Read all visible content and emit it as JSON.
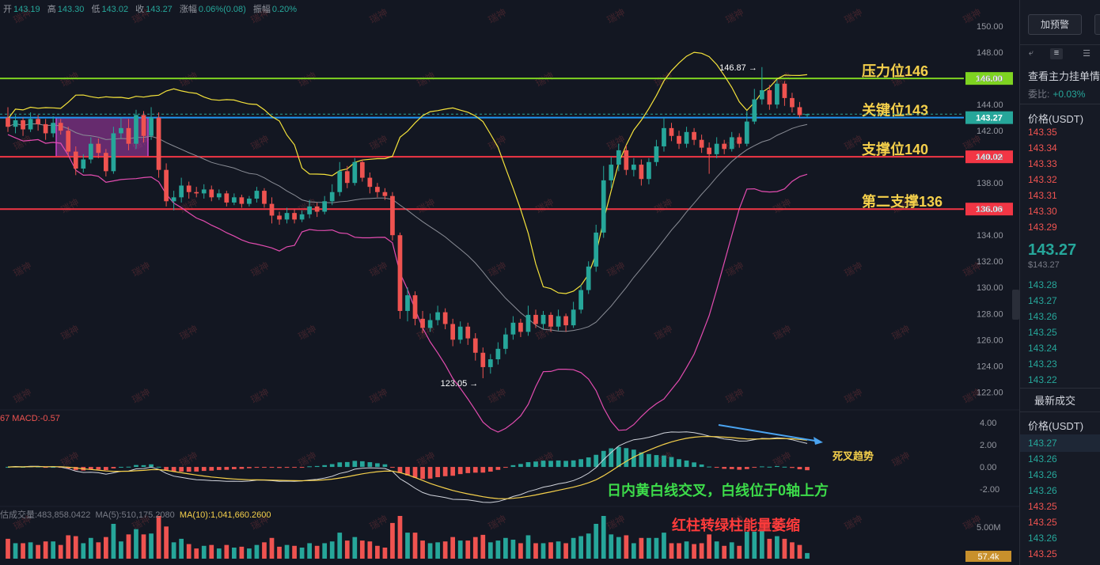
{
  "ohlc": {
    "open_label": "开",
    "open": "143.19",
    "high_label": "高",
    "high": "143.30",
    "low_label": "低",
    "low": "143.02",
    "close_label": "收",
    "close": "143.27",
    "change_label": "涨幅",
    "change": "0.06%(0.08)",
    "amp_label": "振幅",
    "amp": "0.20%"
  },
  "macd_legend": "67  MACD:-0.57",
  "vol_legend": {
    "base": "估成交量:483,858.0422",
    "ma5": "MA(5):510,175.2080",
    "ma10": "MA(10):1,041,660.2600"
  },
  "chart_data": {
    "type": "candlestick",
    "price_axis": {
      "ylim": [
        120.2,
        151.4
      ],
      "ticks": [
        "150.00",
        "148.00",
        "146.00",
        "144.00",
        "142.00",
        "140.00",
        "138.00",
        "136.00",
        "134.00",
        "132.00",
        "130.00",
        "128.00",
        "126.00",
        "124.00",
        "122.00"
      ],
      "tick_values": [
        150,
        148,
        146,
        144,
        142,
        140,
        138,
        136,
        134,
        132,
        130,
        128,
        126,
        124,
        122
      ]
    },
    "macd_axis": {
      "ticks": [
        "4.00",
        "2.00",
        "0.00",
        "-2.00"
      ],
      "tick_values": [
        4,
        2,
        0,
        -2
      ]
    },
    "volume_axis": {
      "ticks": [
        "5.00M"
      ],
      "last_label": "57.4k"
    },
    "last_price_label": "143.27",
    "levels": [
      {
        "value": 146.0,
        "label": "146.00",
        "text": "压力位146",
        "color": "#7ed321"
      },
      {
        "value": 143.0,
        "label": "143.27",
        "text": "关键位143",
        "color": "#2196f3"
      },
      {
        "value": 140.0,
        "label": "140.02",
        "text": "支撑位140",
        "color": "#f23645"
      },
      {
        "value": 136.0,
        "label": "136.06",
        "text": "第二支撑136",
        "color": "#f23645"
      }
    ],
    "extreme_high": {
      "value": 146.87,
      "label": "146.87"
    },
    "extreme_low": {
      "value": 123.05,
      "label": "123.05"
    },
    "annotations": {
      "death_cross": "死叉趋势",
      "macd_note": "日内黄白线交叉，白线位于0轴上方",
      "volume_note": "红柱转绿柱能量萎缩"
    },
    "watermark": "瑞神",
    "colors": {
      "up": "#26a69a",
      "down": "#ef5350",
      "boll_mid": "#8a8d96",
      "boll_up": "#f5e33b",
      "boll_low": "#e34cb0",
      "dif": "#d1d4dc",
      "dea": "#f5d04b",
      "box": "#cc44cc"
    },
    "candles": [
      [
        143.0,
        142.3,
        143.8,
        141.9
      ],
      [
        142.3,
        142.8,
        143.2,
        141.8
      ],
      [
        142.8,
        142.1,
        143.0,
        141.6
      ],
      [
        142.1,
        142.9,
        143.4,
        141.9
      ],
      [
        142.9,
        142.5,
        143.2,
        142.0
      ],
      [
        142.5,
        141.8,
        142.9,
        141.3
      ],
      [
        141.8,
        142.6,
        143.1,
        141.5
      ],
      [
        142.6,
        142.0,
        142.9,
        141.7
      ],
      [
        142.0,
        140.4,
        142.3,
        140.0
      ],
      [
        140.4,
        139.1,
        140.8,
        138.6
      ],
      [
        139.1,
        139.8,
        140.2,
        138.8
      ],
      [
        139.8,
        141.0,
        141.5,
        139.5
      ],
      [
        141.0,
        140.3,
        141.4,
        139.9
      ],
      [
        140.3,
        138.9,
        140.6,
        138.5
      ],
      [
        138.9,
        141.8,
        142.3,
        138.7
      ],
      [
        141.8,
        142.2,
        143.0,
        141.4
      ],
      [
        142.2,
        141.0,
        142.9,
        140.5
      ],
      [
        141.0,
        143.2,
        143.6,
        140.6
      ],
      [
        143.2,
        141.6,
        143.5,
        141.1
      ],
      [
        141.6,
        143.0,
        143.8,
        141.3
      ],
      [
        143.0,
        139.0,
        143.4,
        138.4
      ],
      [
        139.0,
        136.6,
        139.5,
        136.2
      ],
      [
        136.6,
        136.9,
        137.4,
        135.9
      ],
      [
        136.9,
        137.8,
        138.4,
        136.5
      ],
      [
        137.8,
        137.3,
        138.1,
        136.8
      ],
      [
        137.3,
        137.2,
        137.7,
        136.9
      ],
      [
        137.2,
        137.5,
        137.9,
        136.8
      ],
      [
        137.5,
        136.9,
        137.8,
        136.6
      ],
      [
        136.9,
        137.2,
        137.5,
        136.7
      ],
      [
        137.2,
        136.5,
        137.4,
        136.2
      ],
      [
        136.5,
        136.9,
        137.2,
        136.3
      ],
      [
        136.9,
        136.4,
        137.1,
        136.1
      ],
      [
        136.4,
        136.8,
        137.0,
        136.2
      ],
      [
        136.8,
        137.4,
        137.7,
        136.5
      ],
      [
        137.4,
        136.4,
        137.6,
        136.1
      ],
      [
        136.4,
        135.5,
        136.9,
        134.9
      ],
      [
        135.5,
        135.2,
        135.8,
        134.8
      ],
      [
        135.2,
        135.7,
        136.1,
        134.9
      ],
      [
        135.7,
        135.2,
        136.0,
        134.9
      ],
      [
        135.2,
        135.6,
        135.9,
        135.0
      ],
      [
        135.6,
        136.2,
        136.7,
        135.3
      ],
      [
        136.2,
        135.8,
        136.5,
        135.4
      ],
      [
        135.8,
        136.6,
        137.0,
        135.6
      ],
      [
        136.6,
        137.3,
        137.9,
        136.3
      ],
      [
        137.3,
        138.9,
        139.6,
        137.0
      ],
      [
        138.9,
        138.0,
        139.3,
        137.6
      ],
      [
        138.0,
        139.6,
        139.9,
        137.8
      ],
      [
        139.6,
        138.4,
        139.8,
        138.1
      ],
      [
        138.4,
        137.7,
        138.8,
        137.2
      ],
      [
        137.7,
        137.3,
        138.0,
        136.9
      ],
      [
        137.3,
        137.0,
        137.6,
        136.7
      ],
      [
        137.0,
        134.0,
        137.3,
        133.6
      ],
      [
        134.0,
        128.2,
        134.2,
        127.6
      ],
      [
        128.2,
        129.4,
        130.0,
        127.4
      ],
      [
        129.4,
        127.6,
        129.7,
        127.1
      ],
      [
        127.6,
        126.9,
        128.2,
        126.5
      ],
      [
        126.9,
        127.5,
        128.0,
        126.6
      ],
      [
        127.5,
        128.1,
        128.6,
        127.1
      ],
      [
        128.1,
        127.2,
        128.4,
        126.8
      ],
      [
        127.2,
        126.0,
        127.6,
        125.5
      ],
      [
        126.0,
        127.0,
        127.4,
        125.7
      ],
      [
        127.0,
        126.1,
        127.3,
        125.6
      ],
      [
        126.1,
        125.0,
        126.5,
        124.4
      ],
      [
        125.0,
        123.9,
        125.4,
        123.05
      ],
      [
        123.9,
        124.5,
        124.9,
        123.4
      ],
      [
        124.5,
        125.3,
        125.8,
        124.1
      ],
      [
        125.3,
        126.4,
        126.9,
        124.9
      ],
      [
        126.4,
        127.3,
        127.8,
        126.0
      ],
      [
        127.3,
        126.6,
        127.6,
        126.2
      ],
      [
        126.6,
        127.9,
        128.6,
        126.3
      ],
      [
        127.9,
        127.2,
        128.3,
        126.9
      ],
      [
        127.2,
        127.9,
        128.2,
        126.8
      ],
      [
        127.9,
        127.0,
        128.1,
        126.6
      ],
      [
        127.0,
        127.8,
        128.3,
        126.7
      ],
      [
        127.8,
        127.1,
        128.0,
        126.6
      ],
      [
        127.1,
        128.3,
        128.9,
        126.9
      ],
      [
        128.3,
        129.8,
        130.2,
        128.0
      ],
      [
        129.8,
        131.6,
        132.0,
        129.5
      ],
      [
        131.6,
        134.2,
        134.8,
        131.2
      ],
      [
        134.2,
        138.2,
        139.3,
        133.8
      ],
      [
        138.2,
        139.4,
        140.0,
        137.6
      ],
      [
        139.4,
        140.5,
        141.0,
        138.9
      ],
      [
        140.5,
        139.0,
        140.9,
        138.6
      ],
      [
        139.0,
        139.4,
        139.9,
        138.5
      ],
      [
        139.4,
        138.3,
        139.8,
        137.8
      ],
      [
        138.3,
        139.6,
        139.9,
        137.9
      ],
      [
        139.6,
        140.8,
        141.3,
        139.3
      ],
      [
        140.8,
        142.2,
        143.0,
        140.4
      ],
      [
        142.2,
        141.6,
        142.6,
        141.2
      ],
      [
        141.6,
        141.0,
        142.0,
        140.6
      ],
      [
        141.0,
        141.9,
        142.3,
        140.7
      ],
      [
        141.9,
        141.3,
        142.2,
        140.9
      ],
      [
        141.3,
        140.7,
        141.7,
        140.3
      ],
      [
        140.7,
        140.2,
        141.1,
        138.7
      ],
      [
        140.2,
        141.0,
        141.5,
        139.9
      ],
      [
        141.0,
        140.6,
        141.3,
        140.2
      ],
      [
        140.6,
        141.5,
        141.9,
        140.4
      ],
      [
        141.5,
        141.0,
        141.8,
        140.7
      ],
      [
        141.0,
        142.7,
        143.5,
        140.8
      ],
      [
        142.7,
        144.4,
        145.2,
        142.5
      ],
      [
        144.4,
        145.1,
        146.87,
        144.0
      ],
      [
        145.1,
        144.0,
        145.5,
        143.6
      ],
      [
        144.0,
        145.6,
        145.9,
        143.7
      ],
      [
        145.6,
        144.5,
        145.8,
        143.9
      ],
      [
        144.5,
        143.8,
        144.9,
        143.4
      ],
      [
        143.8,
        143.19,
        144.2,
        143.0
      ],
      [
        143.19,
        143.27,
        143.3,
        143.02
      ]
    ]
  },
  "side": {
    "btn1": "加预警",
    "btn2": "已",
    "title": "查看主力挂单情",
    "ratio_label": "委比:",
    "ratio_value": "+0.03%",
    "book_header": "价格(USDT)",
    "asks": [
      "143.35",
      "143.34",
      "143.33",
      "143.32",
      "143.31",
      "143.30",
      "143.29"
    ],
    "mid_price": "143.27",
    "mid_sub": "$143.27",
    "bids": [
      "143.28",
      "143.27",
      "143.26",
      "143.25",
      "143.24",
      "143.23",
      "143.22"
    ],
    "trades_title": "最新成交",
    "trades_header": "价格(USDT)",
    "trades": [
      {
        "p": "143.27",
        "c": "green"
      },
      {
        "p": "143.26",
        "c": "green"
      },
      {
        "p": "143.26",
        "c": "green"
      },
      {
        "p": "143.26",
        "c": "green"
      },
      {
        "p": "143.25",
        "c": "red"
      },
      {
        "p": "143.25",
        "c": "red"
      },
      {
        "p": "143.26",
        "c": "green"
      },
      {
        "p": "143.25",
        "c": "red"
      }
    ]
  }
}
